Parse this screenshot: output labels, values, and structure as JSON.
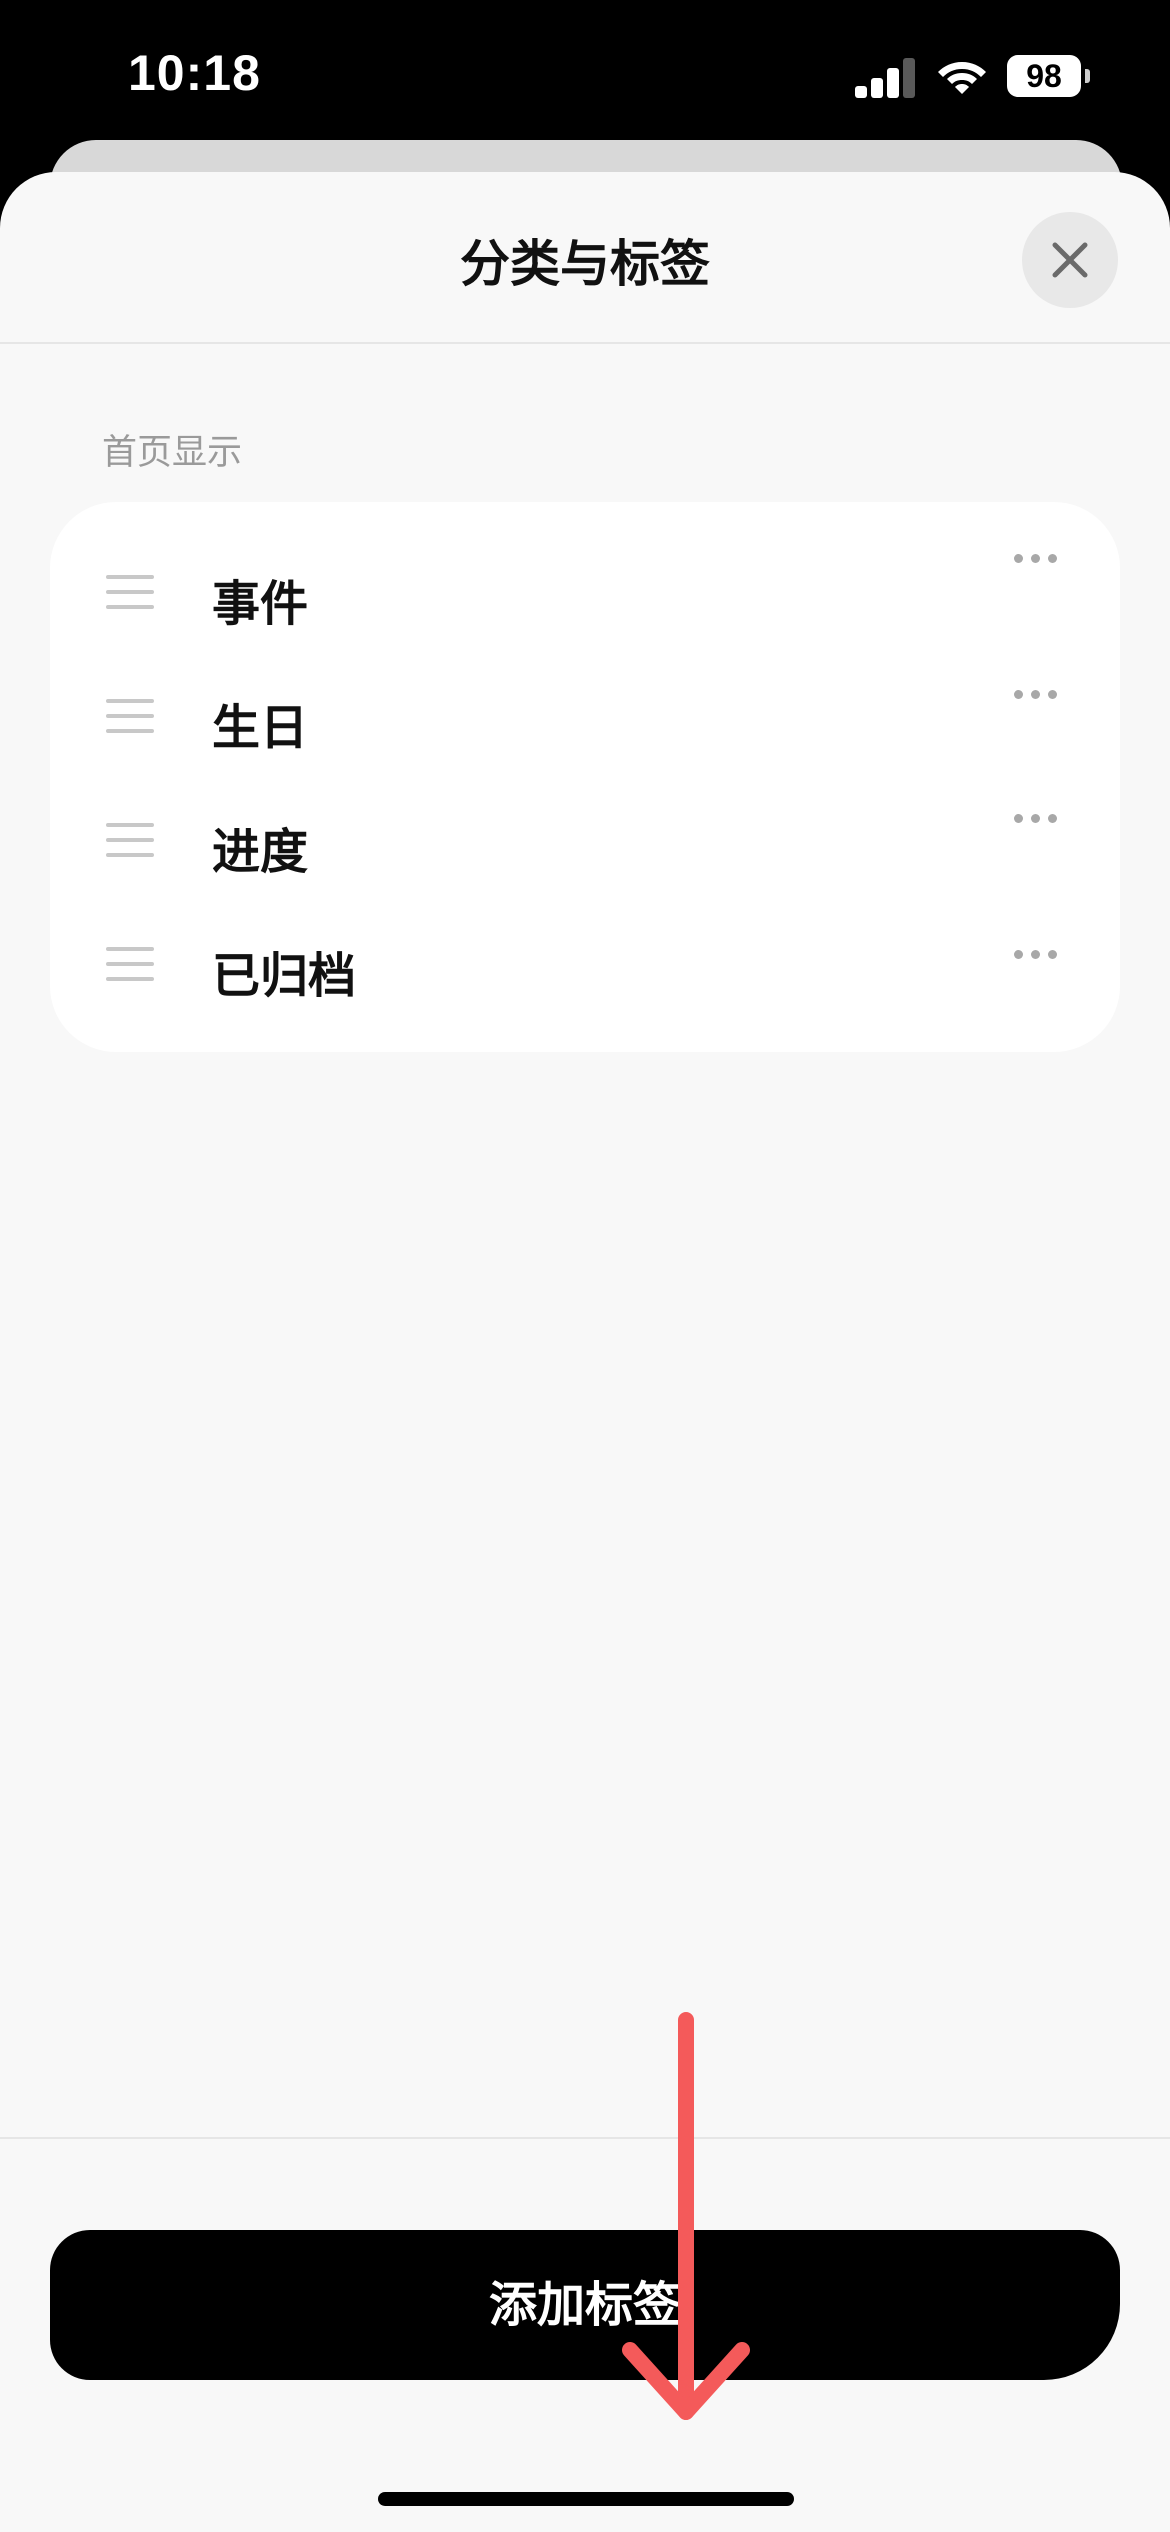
{
  "status_bar": {
    "time": "10:18",
    "battery": "98",
    "icons": [
      "cellular-signal-icon",
      "wifi-icon",
      "battery-icon"
    ]
  },
  "sheet": {
    "title": "分类与标签",
    "close_icon": "close-icon"
  },
  "section": {
    "label": "首页显示",
    "items": [
      {
        "label": "事件"
      },
      {
        "label": "生日"
      },
      {
        "label": "进度"
      },
      {
        "label": "已归档"
      }
    ]
  },
  "footer": {
    "add_button_label": "添加标签"
  },
  "colors": {
    "sheet_background": "#f8f8f8",
    "card_background": "#ffffff",
    "button_background": "#000000",
    "annotation_arrow": "#f45a5a",
    "muted_text": "#9a9a9a"
  }
}
